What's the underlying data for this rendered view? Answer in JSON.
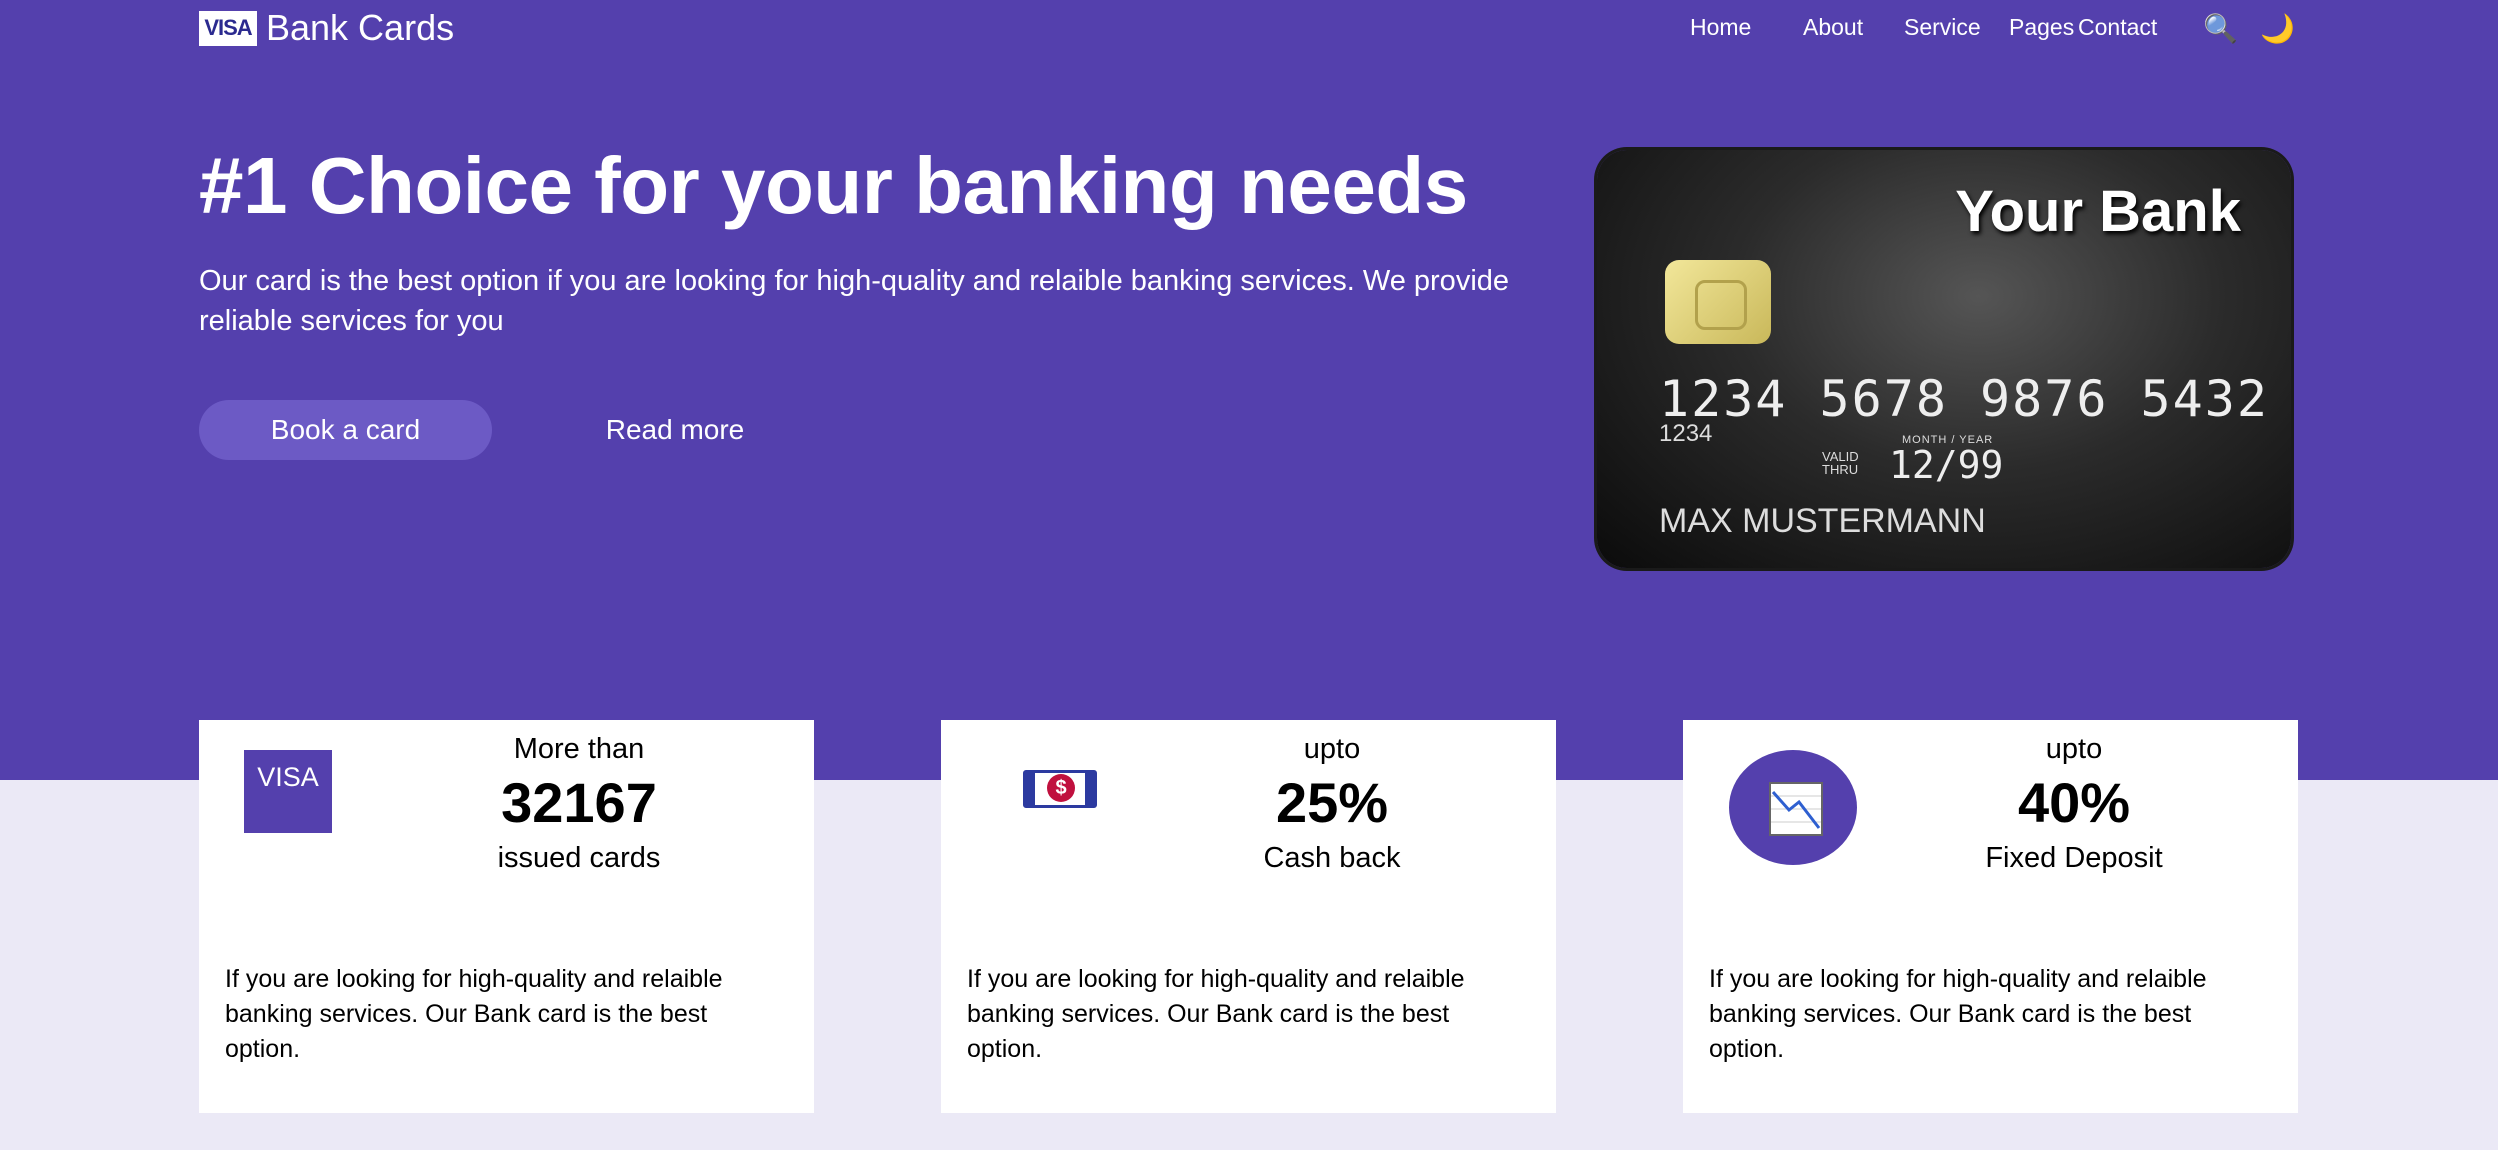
{
  "nav": {
    "brand_logo": "VISA",
    "brand_name": "Bank Cards",
    "links": [
      "Home",
      "About",
      "Service",
      "Pages",
      "Contact"
    ],
    "search_icon": "🔍",
    "theme_icon": "🌙"
  },
  "hero": {
    "title": "#1 Choice for your banking needs",
    "lead": "Our card is the best option if you are looking for high-quality and relaible banking services. We provide reliable services for you",
    "book_label": "Book a card",
    "read_label": "Read more"
  },
  "card": {
    "bank": "Your Bank",
    "number": "1234 5678 9876 5432",
    "small_number": "1234",
    "valid_thru": "VALID THRU",
    "month_year": "MONTH / YEAR",
    "expiry": "12/99",
    "holder": "MAX MUSTERMANN"
  },
  "stats": [
    {
      "icon": "visa-icon",
      "icon_text": "VISA",
      "top": "More than",
      "value": "32167",
      "bottom": "issued cards",
      "desc": "If you are looking for high-quality and relaible banking services. Our Bank card is the best option."
    },
    {
      "icon": "money-icon",
      "icon_text": "$",
      "top": "upto",
      "value": "25%",
      "bottom": "Cash back",
      "desc": "If you are looking for high-quality and relaible banking services. Our Bank card is the best option."
    },
    {
      "icon": "chart-down-icon",
      "icon_text": "",
      "top": "upto",
      "value": "40%",
      "bottom": "Fixed Deposit",
      "desc": "If you are looking for high-quality and relaible banking services. Our Bank card is the best option."
    }
  ],
  "colors": {
    "primary": "#5440ad",
    "button": "#6c5ac5",
    "page_bg": "#ebe9f6"
  }
}
